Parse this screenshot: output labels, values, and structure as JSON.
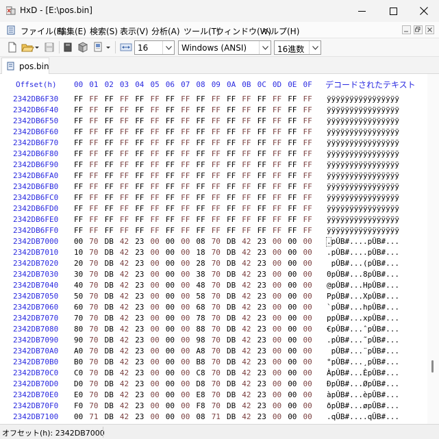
{
  "window": {
    "title": "HxD - [E:\\pos.bin]"
  },
  "menu": {
    "items": [
      "ファイル(F)",
      "編集(E)",
      "検索(S)",
      "表示(V)",
      "分析(A)",
      "ツール(T)",
      "ウィンドウ(W)",
      "ヘルプ(H)"
    ]
  },
  "toolbar": {
    "bytes_per_row": "16",
    "charset": "Windows (ANSI)",
    "offset_base": "16進数"
  },
  "tabs": [
    {
      "label": "pos.bin",
      "active": true
    }
  ],
  "hex": {
    "offset_header": "Offset(h)",
    "columns": [
      "00",
      "01",
      "02",
      "03",
      "04",
      "05",
      "06",
      "07",
      "08",
      "09",
      "0A",
      "0B",
      "0C",
      "0D",
      "0E",
      "0F"
    ],
    "decoded_header": "デコードされたテキスト",
    "rows": [
      {
        "offset": "2342DB6F30",
        "bytes": [
          "FF",
          "FF",
          "FF",
          "FF",
          "FF",
          "FF",
          "FF",
          "FF",
          "FF",
          "FF",
          "FF",
          "FF",
          "FF",
          "FF",
          "FF",
          "FF"
        ],
        "text": "ÿÿÿÿÿÿÿÿÿÿÿÿÿÿÿÿ"
      },
      {
        "offset": "2342DB6F40",
        "bytes": [
          "FF",
          "FF",
          "FF",
          "FF",
          "FF",
          "FF",
          "FF",
          "FF",
          "FF",
          "FF",
          "FF",
          "FF",
          "FF",
          "FF",
          "FF",
          "FF"
        ],
        "text": "ÿÿÿÿÿÿÿÿÿÿÿÿÿÿÿÿ"
      },
      {
        "offset": "2342DB6F50",
        "bytes": [
          "FF",
          "FF",
          "FF",
          "FF",
          "FF",
          "FF",
          "FF",
          "FF",
          "FF",
          "FF",
          "FF",
          "FF",
          "FF",
          "FF",
          "FF",
          "FF"
        ],
        "text": "ÿÿÿÿÿÿÿÿÿÿÿÿÿÿÿÿ"
      },
      {
        "offset": "2342DB6F60",
        "bytes": [
          "FF",
          "FF",
          "FF",
          "FF",
          "FF",
          "FF",
          "FF",
          "FF",
          "FF",
          "FF",
          "FF",
          "FF",
          "FF",
          "FF",
          "FF",
          "FF"
        ],
        "text": "ÿÿÿÿÿÿÿÿÿÿÿÿÿÿÿÿ"
      },
      {
        "offset": "2342DB6F70",
        "bytes": [
          "FF",
          "FF",
          "FF",
          "FF",
          "FF",
          "FF",
          "FF",
          "FF",
          "FF",
          "FF",
          "FF",
          "FF",
          "FF",
          "FF",
          "FF",
          "FF"
        ],
        "text": "ÿÿÿÿÿÿÿÿÿÿÿÿÿÿÿÿ"
      },
      {
        "offset": "2342DB6F80",
        "bytes": [
          "FF",
          "FF",
          "FF",
          "FF",
          "FF",
          "FF",
          "FF",
          "FF",
          "FF",
          "FF",
          "FF",
          "FF",
          "FF",
          "FF",
          "FF",
          "FF"
        ],
        "text": "ÿÿÿÿÿÿÿÿÿÿÿÿÿÿÿÿ"
      },
      {
        "offset": "2342DB6F90",
        "bytes": [
          "FF",
          "FF",
          "FF",
          "FF",
          "FF",
          "FF",
          "FF",
          "FF",
          "FF",
          "FF",
          "FF",
          "FF",
          "FF",
          "FF",
          "FF",
          "FF"
        ],
        "text": "ÿÿÿÿÿÿÿÿÿÿÿÿÿÿÿÿ"
      },
      {
        "offset": "2342DB6FA0",
        "bytes": [
          "FF",
          "FF",
          "FF",
          "FF",
          "FF",
          "FF",
          "FF",
          "FF",
          "FF",
          "FF",
          "FF",
          "FF",
          "FF",
          "FF",
          "FF",
          "FF"
        ],
        "text": "ÿÿÿÿÿÿÿÿÿÿÿÿÿÿÿÿ"
      },
      {
        "offset": "2342DB6FB0",
        "bytes": [
          "FF",
          "FF",
          "FF",
          "FF",
          "FF",
          "FF",
          "FF",
          "FF",
          "FF",
          "FF",
          "FF",
          "FF",
          "FF",
          "FF",
          "FF",
          "FF"
        ],
        "text": "ÿÿÿÿÿÿÿÿÿÿÿÿÿÿÿÿ"
      },
      {
        "offset": "2342DB6FC0",
        "bytes": [
          "FF",
          "FF",
          "FF",
          "FF",
          "FF",
          "FF",
          "FF",
          "FF",
          "FF",
          "FF",
          "FF",
          "FF",
          "FF",
          "FF",
          "FF",
          "FF"
        ],
        "text": "ÿÿÿÿÿÿÿÿÿÿÿÿÿÿÿÿ"
      },
      {
        "offset": "2342DB6FD0",
        "bytes": [
          "FF",
          "FF",
          "FF",
          "FF",
          "FF",
          "FF",
          "FF",
          "FF",
          "FF",
          "FF",
          "FF",
          "FF",
          "FF",
          "FF",
          "FF",
          "FF"
        ],
        "text": "ÿÿÿÿÿÿÿÿÿÿÿÿÿÿÿÿ"
      },
      {
        "offset": "2342DB6FE0",
        "bytes": [
          "FF",
          "FF",
          "FF",
          "FF",
          "FF",
          "FF",
          "FF",
          "FF",
          "FF",
          "FF",
          "FF",
          "FF",
          "FF",
          "FF",
          "FF",
          "FF"
        ],
        "text": "ÿÿÿÿÿÿÿÿÿÿÿÿÿÿÿÿ"
      },
      {
        "offset": "2342DB6FF0",
        "bytes": [
          "FF",
          "FF",
          "FF",
          "FF",
          "FF",
          "FF",
          "FF",
          "FF",
          "FF",
          "FF",
          "FF",
          "FF",
          "FF",
          "FF",
          "FF",
          "FF"
        ],
        "text": "ÿÿÿÿÿÿÿÿÿÿÿÿÿÿÿÿ"
      },
      {
        "offset": "2342DB7000",
        "bytes": [
          "00",
          "70",
          "DB",
          "42",
          "23",
          "00",
          "00",
          "00",
          "08",
          "70",
          "DB",
          "42",
          "23",
          "00",
          "00",
          "00"
        ],
        "text": ".pÛB#....pÛB#..."
      },
      {
        "offset": "2342DB7010",
        "bytes": [
          "10",
          "70",
          "DB",
          "42",
          "23",
          "00",
          "00",
          "00",
          "18",
          "70",
          "DB",
          "42",
          "23",
          "00",
          "00",
          "00"
        ],
        "text": ".pÛB#....pÛB#..."
      },
      {
        "offset": "2342DB7020",
        "bytes": [
          "20",
          "70",
          "DB",
          "42",
          "23",
          "00",
          "00",
          "00",
          "28",
          "70",
          "DB",
          "42",
          "23",
          "00",
          "00",
          "00"
        ],
        "text": " pÛB#...(pÛB#..."
      },
      {
        "offset": "2342DB7030",
        "bytes": [
          "30",
          "70",
          "DB",
          "42",
          "23",
          "00",
          "00",
          "00",
          "38",
          "70",
          "DB",
          "42",
          "23",
          "00",
          "00",
          "00"
        ],
        "text": "0pÛB#...8pÛB#..."
      },
      {
        "offset": "2342DB7040",
        "bytes": [
          "40",
          "70",
          "DB",
          "42",
          "23",
          "00",
          "00",
          "00",
          "48",
          "70",
          "DB",
          "42",
          "23",
          "00",
          "00",
          "00"
        ],
        "text": "@pÛB#...HpÛB#..."
      },
      {
        "offset": "2342DB7050",
        "bytes": [
          "50",
          "70",
          "DB",
          "42",
          "23",
          "00",
          "00",
          "00",
          "58",
          "70",
          "DB",
          "42",
          "23",
          "00",
          "00",
          "00"
        ],
        "text": "PpÛB#...XpÛB#..."
      },
      {
        "offset": "2342DB7060",
        "bytes": [
          "60",
          "70",
          "DB",
          "42",
          "23",
          "00",
          "00",
          "00",
          "68",
          "70",
          "DB",
          "42",
          "23",
          "00",
          "00",
          "00"
        ],
        "text": "`pÛB#...hpÛB#..."
      },
      {
        "offset": "2342DB7070",
        "bytes": [
          "70",
          "70",
          "DB",
          "42",
          "23",
          "00",
          "00",
          "00",
          "78",
          "70",
          "DB",
          "42",
          "23",
          "00",
          "00",
          "00"
        ],
        "text": "ppÛB#...xpÛB#..."
      },
      {
        "offset": "2342DB7080",
        "bytes": [
          "80",
          "70",
          "DB",
          "42",
          "23",
          "00",
          "00",
          "00",
          "88",
          "70",
          "DB",
          "42",
          "23",
          "00",
          "00",
          "00"
        ],
        "text": "€pÛB#...ˆpÛB#..."
      },
      {
        "offset": "2342DB7090",
        "bytes": [
          "90",
          "70",
          "DB",
          "42",
          "23",
          "00",
          "00",
          "00",
          "98",
          "70",
          "DB",
          "42",
          "23",
          "00",
          "00",
          "00"
        ],
        "text": ".pÛB#...˜pÛB#..."
      },
      {
        "offset": "2342DB70A0",
        "bytes": [
          "A0",
          "70",
          "DB",
          "42",
          "23",
          "00",
          "00",
          "00",
          "A8",
          "70",
          "DB",
          "42",
          "23",
          "00",
          "00",
          "00"
        ],
        "text": " pÛB#...¨pÛB#..."
      },
      {
        "offset": "2342DB70B0",
        "bytes": [
          "B0",
          "70",
          "DB",
          "42",
          "23",
          "00",
          "00",
          "00",
          "B8",
          "70",
          "DB",
          "42",
          "23",
          "00",
          "00",
          "00"
        ],
        "text": "°pÛB#...¸pÛB#..."
      },
      {
        "offset": "2342DB70C0",
        "bytes": [
          "C0",
          "70",
          "DB",
          "42",
          "23",
          "00",
          "00",
          "00",
          "C8",
          "70",
          "DB",
          "42",
          "23",
          "00",
          "00",
          "00"
        ],
        "text": "ÀpÛB#...ÈpÛB#..."
      },
      {
        "offset": "2342DB70D0",
        "bytes": [
          "D0",
          "70",
          "DB",
          "42",
          "23",
          "00",
          "00",
          "00",
          "D8",
          "70",
          "DB",
          "42",
          "23",
          "00",
          "00",
          "00"
        ],
        "text": "ÐpÛB#...ØpÛB#..."
      },
      {
        "offset": "2342DB70E0",
        "bytes": [
          "E0",
          "70",
          "DB",
          "42",
          "23",
          "00",
          "00",
          "00",
          "E8",
          "70",
          "DB",
          "42",
          "23",
          "00",
          "00",
          "00"
        ],
        "text": "àpÛB#...èpÛB#..."
      },
      {
        "offset": "2342DB70F0",
        "bytes": [
          "F0",
          "70",
          "DB",
          "42",
          "23",
          "00",
          "00",
          "00",
          "F8",
          "70",
          "DB",
          "42",
          "23",
          "00",
          "00",
          "00"
        ],
        "text": "ðpÛB#...øpÛB#..."
      },
      {
        "offset": "2342DB7100",
        "bytes": [
          "00",
          "71",
          "DB",
          "42",
          "23",
          "00",
          "00",
          "00",
          "08",
          "71",
          "DB",
          "42",
          "23",
          "00",
          "00",
          "00"
        ],
        "text": ".qÛB#....qÛB#..."
      }
    ]
  },
  "status": {
    "offset": "オフセット(h): 2342DB7000"
  },
  "colors": {
    "offset_blue": "#2a2ae0",
    "byte_alt": "#7a3f3f"
  }
}
